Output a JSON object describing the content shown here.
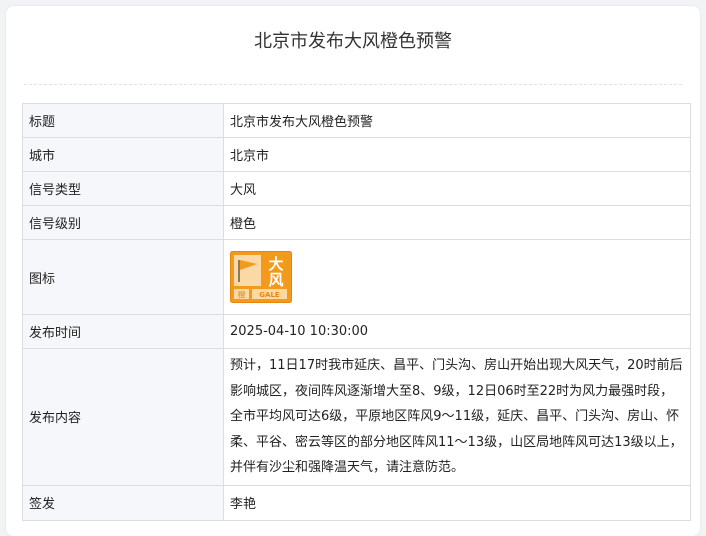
{
  "page": {
    "title": "北京市发布大风橙色预警"
  },
  "table": {
    "rows": [
      {
        "label": "标题",
        "value": "北京市发布大风橙色预警"
      },
      {
        "label": "城市",
        "value": "北京市"
      },
      {
        "label": "信号类型",
        "value": "大风"
      },
      {
        "label": "信号级别",
        "value": "橙色"
      },
      {
        "label": "图标"
      },
      {
        "label": "发布时间",
        "value": "2025-04-10 10:30:00"
      },
      {
        "label": "发布内容",
        "value": "预计，11日17时我市延庆、昌平、门头沟、房山开始出现大风天气，20时前后影响城区，夜间阵风逐渐增大至8、9级，12日06时至22时为风力最强时段，全市平均风可达6级，平原地区阵风9～11级，延庆、昌平、门头沟、房山、怀柔、平谷、密云等区的部分地区阵风11～13级，山区局地阵风可达13级以上，并伴有沙尘和强降温天气，请注意防范。"
      },
      {
        "label": "签发",
        "value": "李艳"
      }
    ]
  },
  "icon": {
    "name": "gale-orange-warning-icon",
    "text_top": "大",
    "text_bottom": "风",
    "text_small_left": "橙",
    "text_small_right": "GALE",
    "colors": {
      "orange": "#f39a1c",
      "orange_dark": "#e88710",
      "panel": "#fbd9a6",
      "white": "#ffffff"
    }
  }
}
